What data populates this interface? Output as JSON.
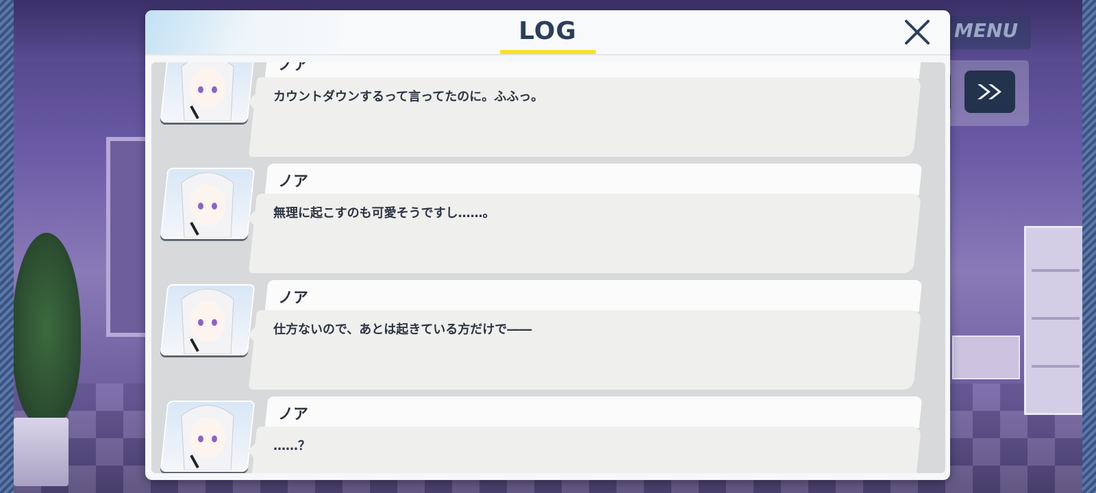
{
  "hud": {
    "menu_label": "MENU"
  },
  "log": {
    "title": "LOG",
    "entries": [
      {
        "speaker": "ノア",
        "text": "カウントダウンするって言ってたのに。ふふっ。"
      },
      {
        "speaker": "ノア",
        "text": "無理に起こすのも可愛そうですし……。"
      },
      {
        "speaker": "ノア",
        "text": "仕方ないので、あとは起きている方だけで――"
      },
      {
        "speaker": "ノア",
        "text": "……？"
      }
    ]
  },
  "colors": {
    "title_underline": "#f7e02b",
    "title_text": "#2c3e5a",
    "hud_button": "#23324d"
  },
  "icons": {
    "close": "close-icon",
    "skip": "fast-forward-icon"
  }
}
